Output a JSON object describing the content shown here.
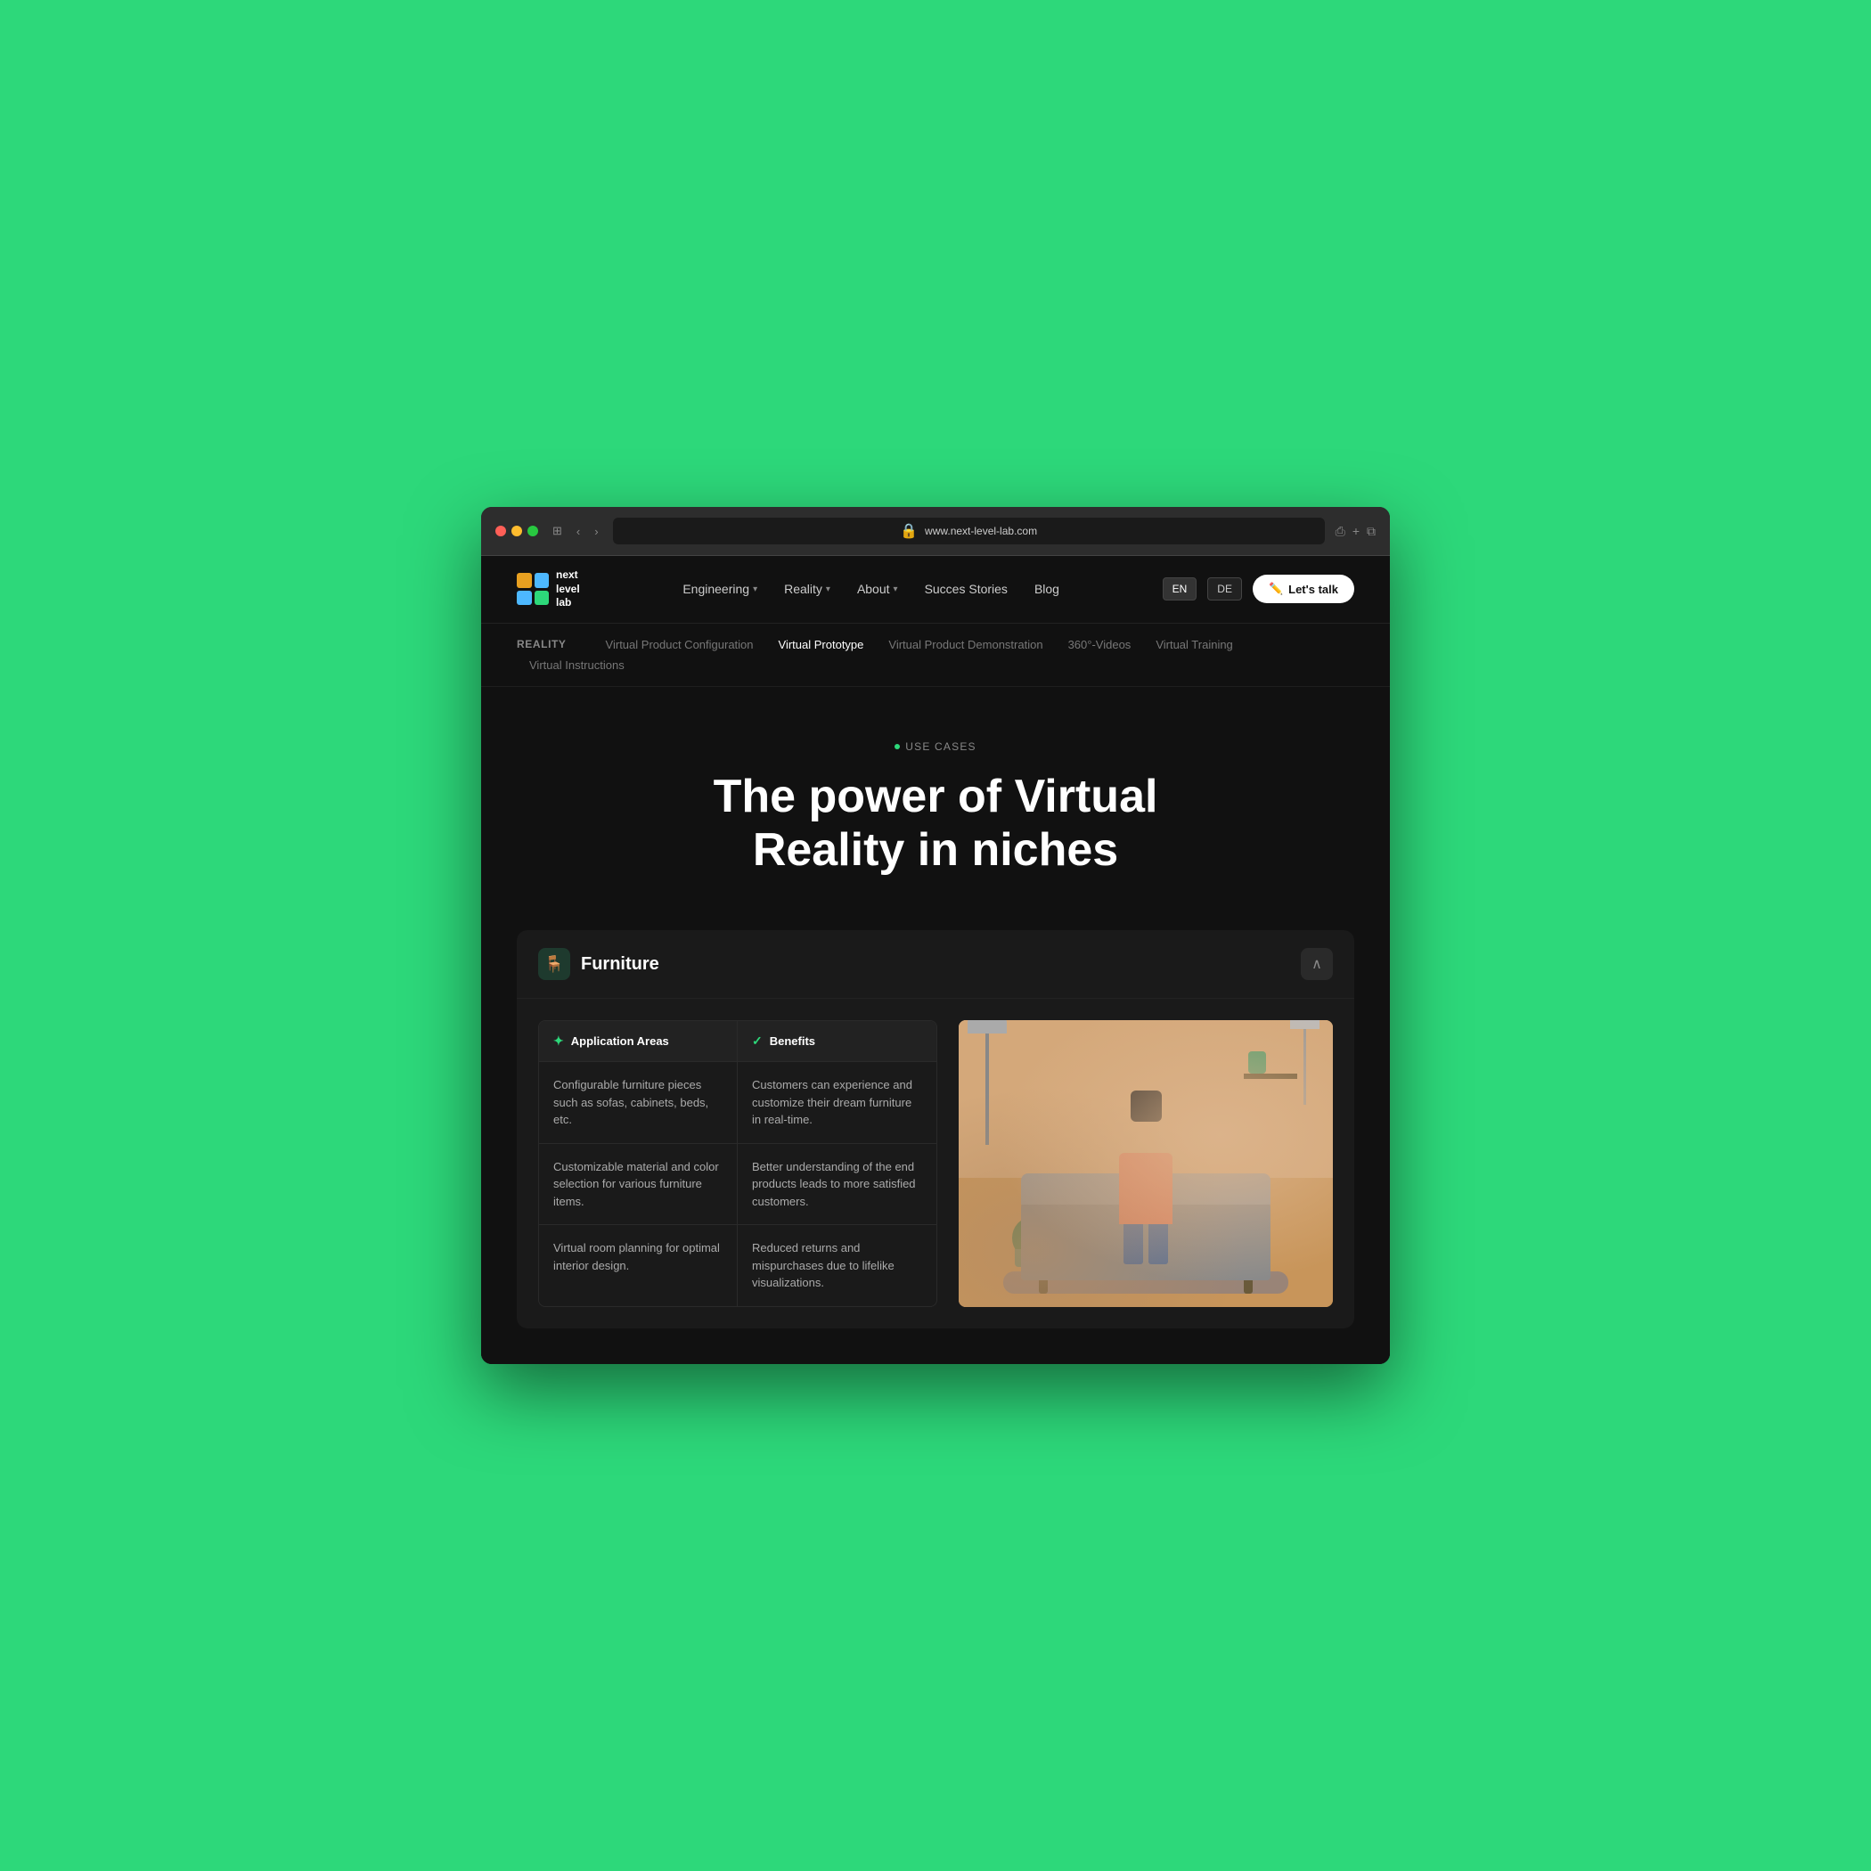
{
  "browser": {
    "url": "www.next-level-lab.com",
    "tab_icon": "🔒"
  },
  "logo": {
    "line1": "next",
    "line2": "level",
    "line3": "lab"
  },
  "nav": {
    "links": [
      {
        "label": "Engineering",
        "hasDropdown": true
      },
      {
        "label": "Reality",
        "hasDropdown": true
      },
      {
        "label": "About",
        "hasDropdown": true
      },
      {
        "label": "Succes Stories",
        "hasDropdown": false
      },
      {
        "label": "Blog",
        "hasDropdown": false
      }
    ],
    "lang_en": "EN",
    "lang_de": "DE",
    "cta_icon": "✏️",
    "cta_label": "Let's talk"
  },
  "subnav": {
    "section_label": "REALITY",
    "items": [
      {
        "label": "Virtual Product Configuration",
        "active": false
      },
      {
        "label": "Virtual Prototype",
        "active": false
      },
      {
        "label": "Virtual Product Demonstration",
        "active": false
      },
      {
        "label": "360°-Videos",
        "active": false
      },
      {
        "label": "Virtual Training",
        "active": false
      },
      {
        "label": "Virtual Instructions",
        "active": false
      }
    ]
  },
  "hero": {
    "badge": "USE CASES",
    "title_line1": "The power of Virtual",
    "title_line2": "Reality in niches"
  },
  "furniture_card": {
    "icon": "🪑",
    "title": "Furniture",
    "collapse_icon": "∧",
    "table": {
      "col1_header": "Application Areas",
      "col1_icon": "✦",
      "col2_header": "Benefits",
      "col2_icon": "✓",
      "rows": [
        {
          "app": "Configurable furniture pieces such as sofas, cabinets, beds, etc.",
          "ben": "Customers can experience and customize their dream furniture in real-time."
        },
        {
          "app": "Customizable material and color selection for various furniture items.",
          "ben": "Better understanding of the end products leads to more satisfied customers."
        },
        {
          "app": "Virtual room planning for optimal interior design.",
          "ben": "Reduced returns and mispurchases due to lifelike visualizations."
        }
      ]
    }
  }
}
